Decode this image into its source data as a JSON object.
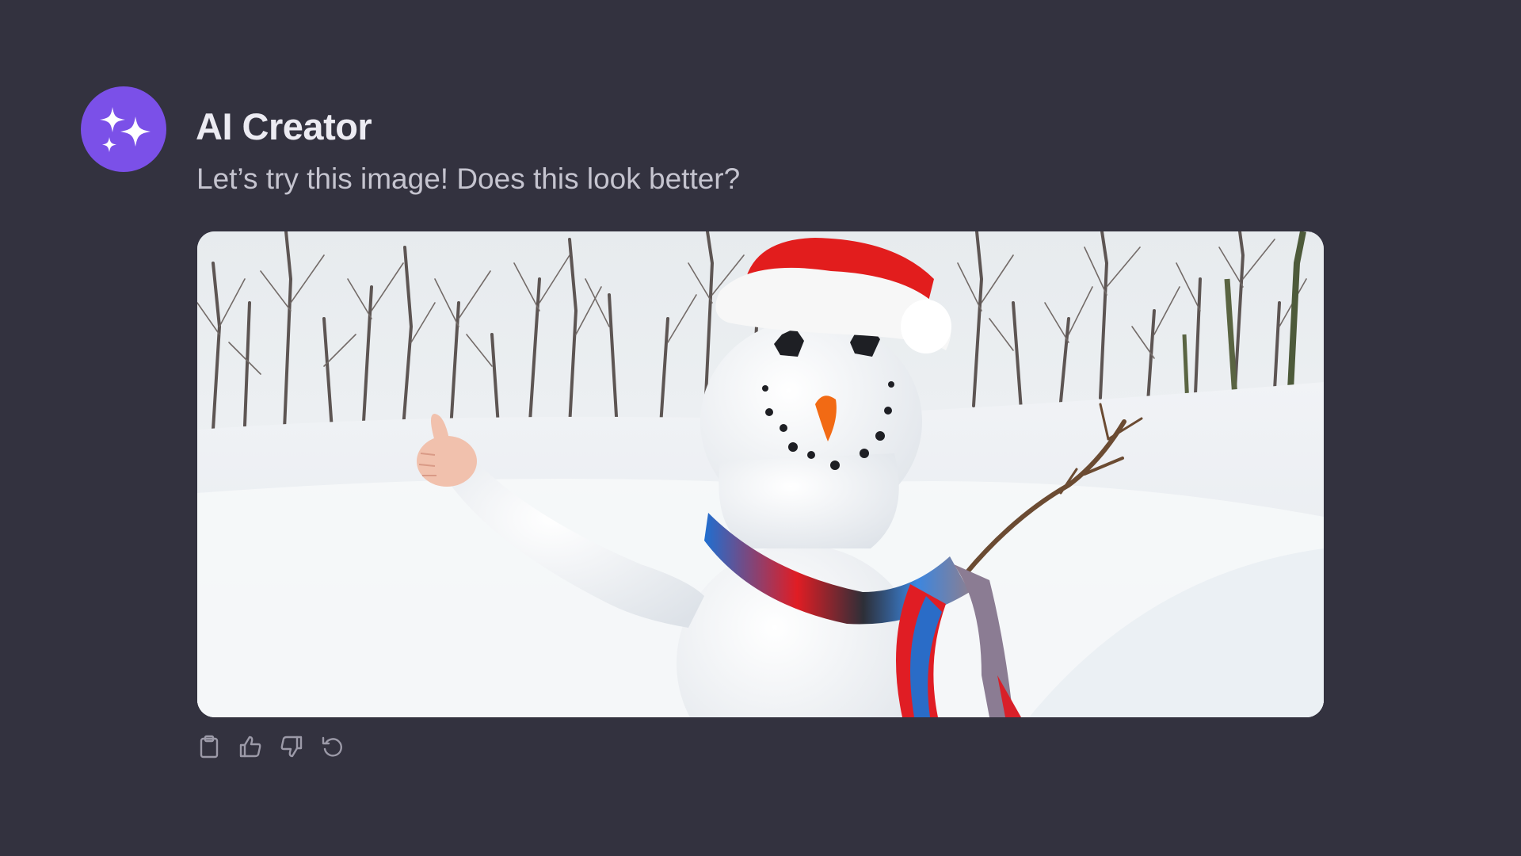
{
  "message": {
    "sender": "AI Creator",
    "text": "Let’s try this image! Does this look better?",
    "avatar_icon": "sparkles-icon",
    "avatar_color": "#7b50e8",
    "image": {
      "subject": "snowman-in-snowy-forest",
      "hat_color": "#e21d1d",
      "nose_color": "#f26a14"
    }
  },
  "actions": [
    {
      "name": "copy",
      "icon": "clipboard-icon"
    },
    {
      "name": "like",
      "icon": "thumbs-up-icon"
    },
    {
      "name": "dislike",
      "icon": "thumbs-down-icon"
    },
    {
      "name": "regenerate",
      "icon": "refresh-icon"
    }
  ],
  "colors": {
    "background": "#33323f",
    "title": "#ecebf2",
    "body_text": "#c5c4cf",
    "icon": "#9c9aa8"
  }
}
